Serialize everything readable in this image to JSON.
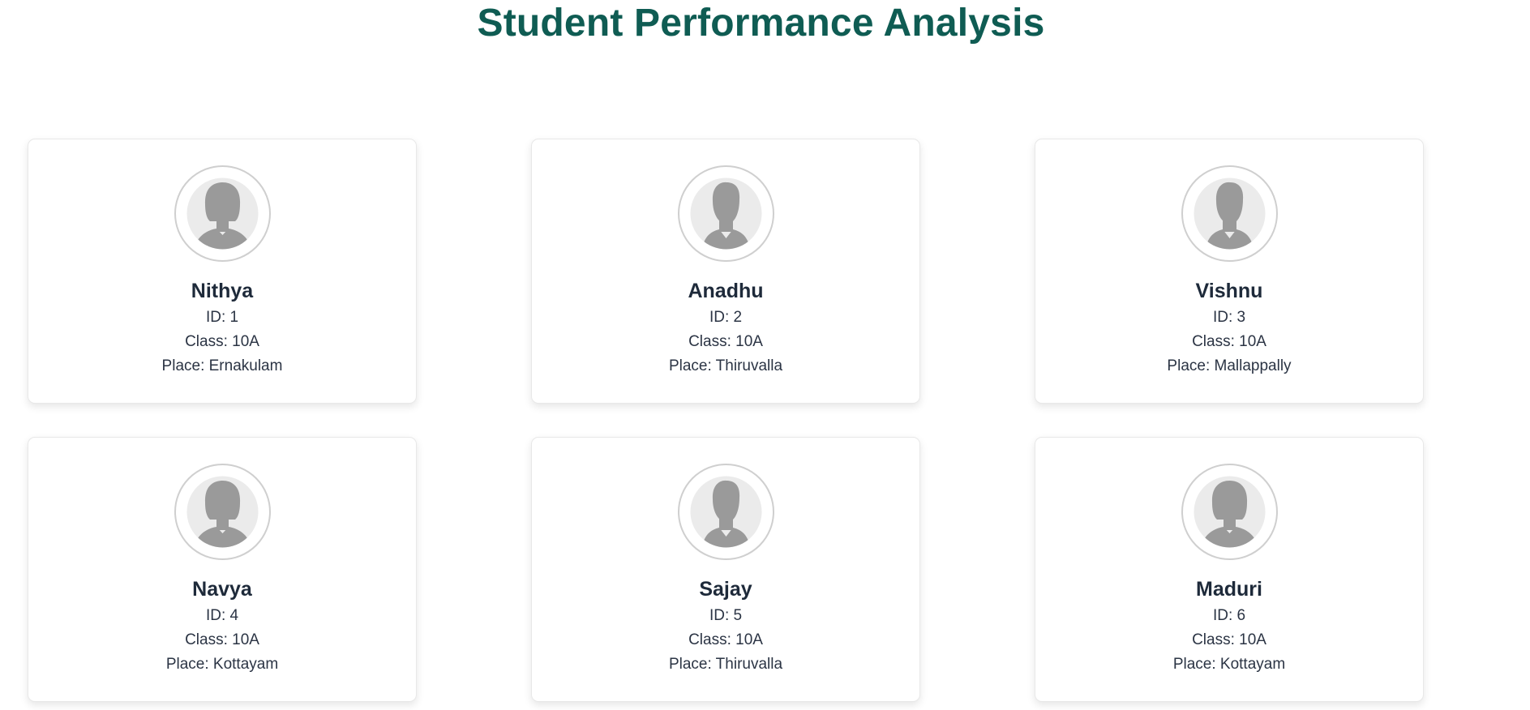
{
  "page": {
    "title": "Student Performance Analysis"
  },
  "students": [
    {
      "name": "Nithya",
      "id": "ID: 1",
      "class": "Class: 10A",
      "place": "Place: Ernakulam",
      "avatar": "female-avatar-icon"
    },
    {
      "name": "Anadhu",
      "id": "ID: 2",
      "class": "Class: 10A",
      "place": "Place: Thiruvalla",
      "avatar": "male-avatar-icon"
    },
    {
      "name": "Vishnu",
      "id": "ID: 3",
      "class": "Class: 10A",
      "place": "Place: Mallappally",
      "avatar": "male-avatar-icon"
    },
    {
      "name": "Navya",
      "id": "ID: 4",
      "class": "Class: 10A",
      "place": "Place: Kottayam",
      "avatar": "female-avatar-icon"
    },
    {
      "name": "Sajay",
      "id": "ID: 5",
      "class": "Class: 10A",
      "place": "Place: Thiruvalla",
      "avatar": "male-avatar-icon"
    },
    {
      "name": "Maduri",
      "id": "ID: 6",
      "class": "Class: 10A",
      "place": "Place: Kottayam",
      "avatar": "female-avatar-icon"
    }
  ],
  "colors": {
    "title": "#0f5c53",
    "avatar_fill": "#9a9a9a",
    "avatar_bg": "#ebebeb",
    "card_border": "#e8e8e8"
  }
}
